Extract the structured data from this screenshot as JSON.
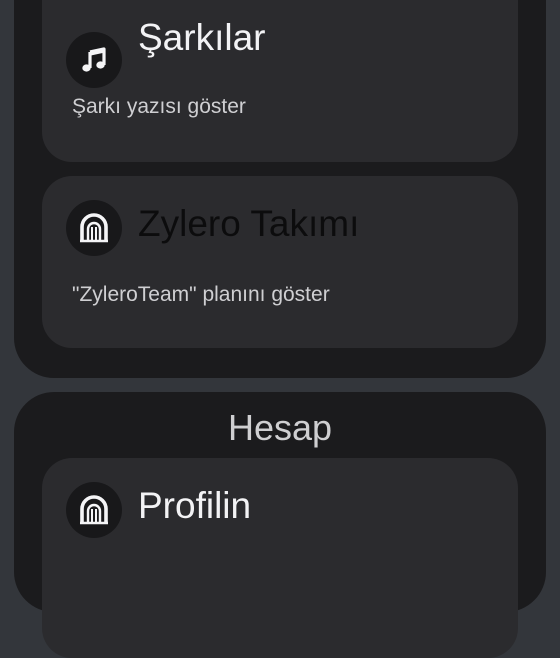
{
  "settings": {
    "cards": [
      {
        "icon": "music-note-icon",
        "title": "Şarkılar",
        "subtitle": "Şarkı yazısı göster"
      },
      {
        "icon": "arch-gate-icon",
        "title": "Zylero Takımı",
        "subtitle": "\"ZyleroTeam\" planını göster"
      }
    ]
  },
  "account": {
    "section_title": "Hesap",
    "cards": [
      {
        "icon": "arch-gate-icon",
        "title": "Profilin"
      }
    ]
  }
}
